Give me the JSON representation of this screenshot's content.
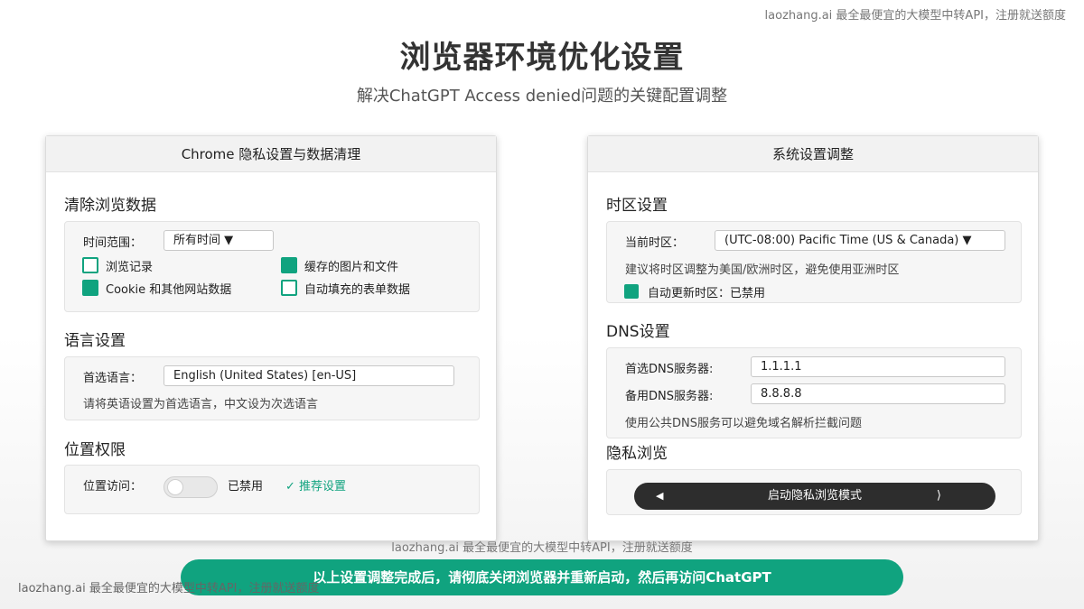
{
  "watermark": "laozhang.ai 最全最便宜的大模型中转API，注册就送额度",
  "title": "浏览器环境优化设置",
  "subtitle": "解决ChatGPT Access denied问题的关键配置调整",
  "accent_color": "#10a37f",
  "left_panel": {
    "header": "Chrome 隐私设置与数据清理",
    "clear_data": {
      "title": "清除浏览数据",
      "time_range_label": "时间范围：",
      "time_range_value": "所有时间 ▼",
      "checkboxes": [
        {
          "label": "浏览记录",
          "checked": false
        },
        {
          "label": "缓存的图片和文件",
          "checked": true
        },
        {
          "label": "Cookie 和其他网站数据",
          "checked": true
        },
        {
          "label": "自动填充的表单数据",
          "checked": false
        }
      ]
    },
    "language": {
      "title": "语言设置",
      "preferred_label": "首选语言：",
      "preferred_value": "English (United States) [en-US]",
      "hint": "请将英语设置为首选语言，中文设为次选语言"
    },
    "location": {
      "title": "位置权限",
      "access_label": "位置访问：",
      "toggle_on": false,
      "status": "已禁用",
      "recommend": "✓ 推荐设置"
    }
  },
  "right_panel": {
    "header": "系统设置调整",
    "timezone": {
      "title": "时区设置",
      "current_label": "当前时区：",
      "current_value": "(UTC-08:00) Pacific Time (US & Canada) ▼",
      "hint": "建议将时区调整为美国/欧洲时区，避免使用亚洲时区",
      "auto_update_label": "自动更新时区：已禁用",
      "auto_update_checked": true
    },
    "dns": {
      "title": "DNS设置",
      "primary_label": "首选DNS服务器:",
      "primary_value": "1.1.1.1",
      "secondary_label": "备用DNS服务器:",
      "secondary_value": "8.8.8.8",
      "hint": "使用公共DNS服务可以避免域名解析拦截问题"
    },
    "private": {
      "title": "隐私浏览",
      "button_left_icon": "◀",
      "button_label": "启动隐私浏览模式",
      "button_right_icon": "⟩"
    }
  },
  "banner": "以上设置调整完成后，请彻底关闭浏览器并重新启动，然后再访问ChatGPT"
}
